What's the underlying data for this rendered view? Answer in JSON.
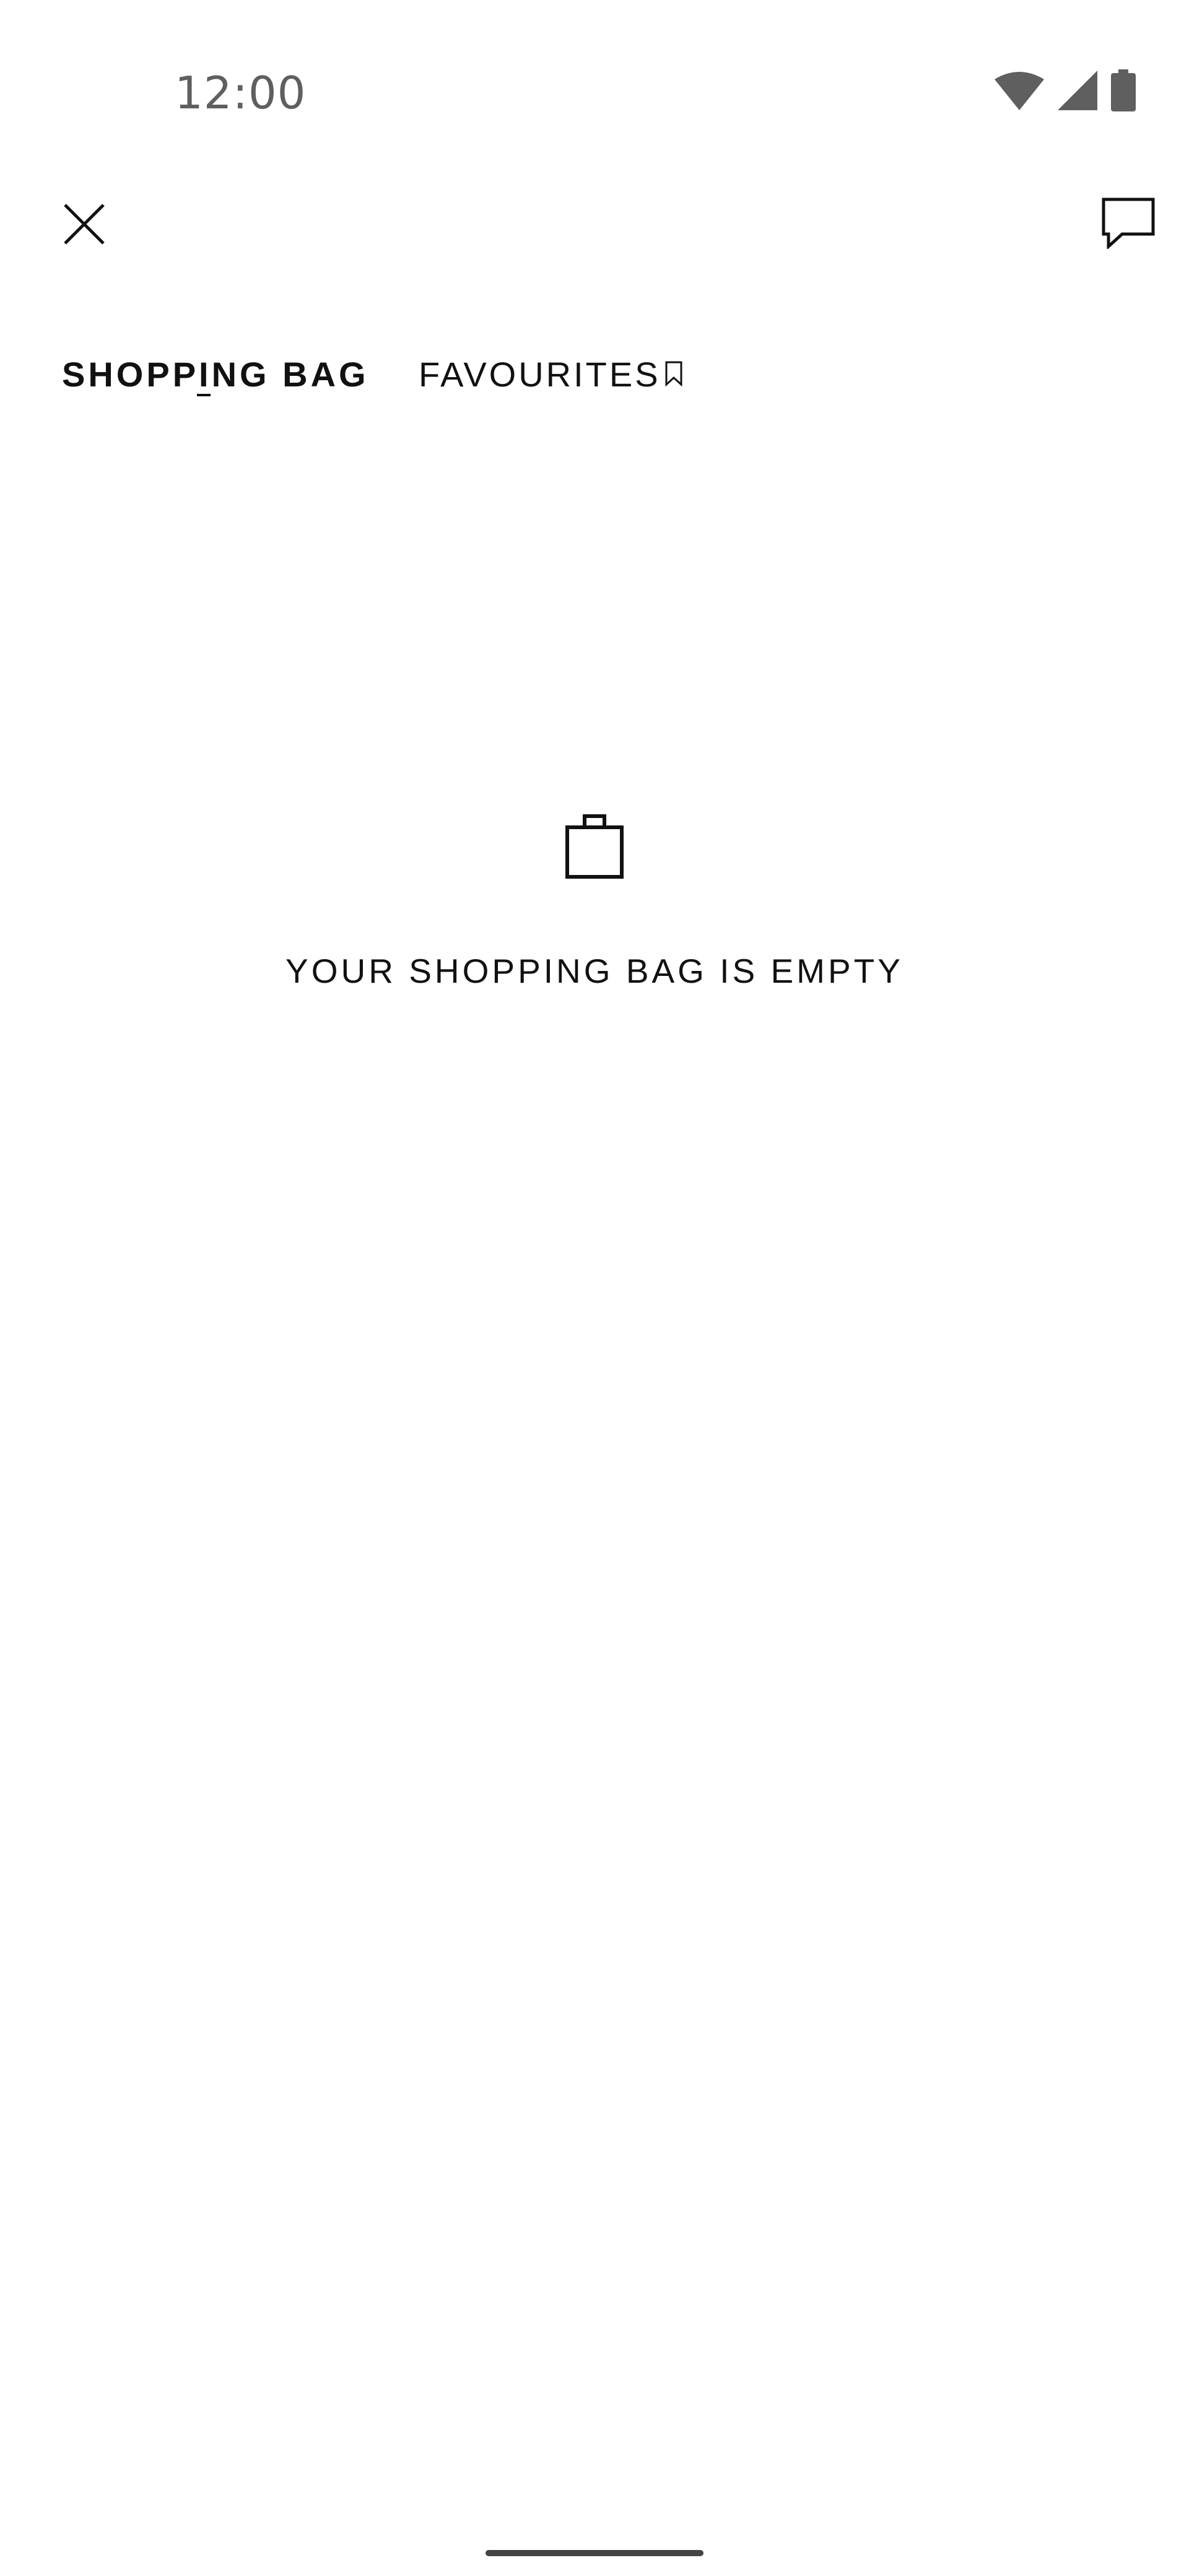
{
  "status_bar": {
    "time": "12:00",
    "icons": [
      "wifi-icon",
      "cellular-signal-icon",
      "battery-icon"
    ]
  },
  "toolbar": {
    "close_icon": "close-icon",
    "chat_icon": "chat-bubble-icon"
  },
  "tabs": [
    {
      "label": "SHOPPING BAG",
      "active": true
    },
    {
      "label": "FAVOURITES",
      "active": false,
      "icon": "bookmark-icon"
    }
  ],
  "empty_state": {
    "icon": "shopping-bag-icon",
    "message": "YOUR SHOPPING BAG IS EMPTY"
  },
  "colors": {
    "background": "#ffffff",
    "text": "#111111",
    "status_text": "#5f5f5f",
    "status_icons": "#5f5f5f"
  }
}
